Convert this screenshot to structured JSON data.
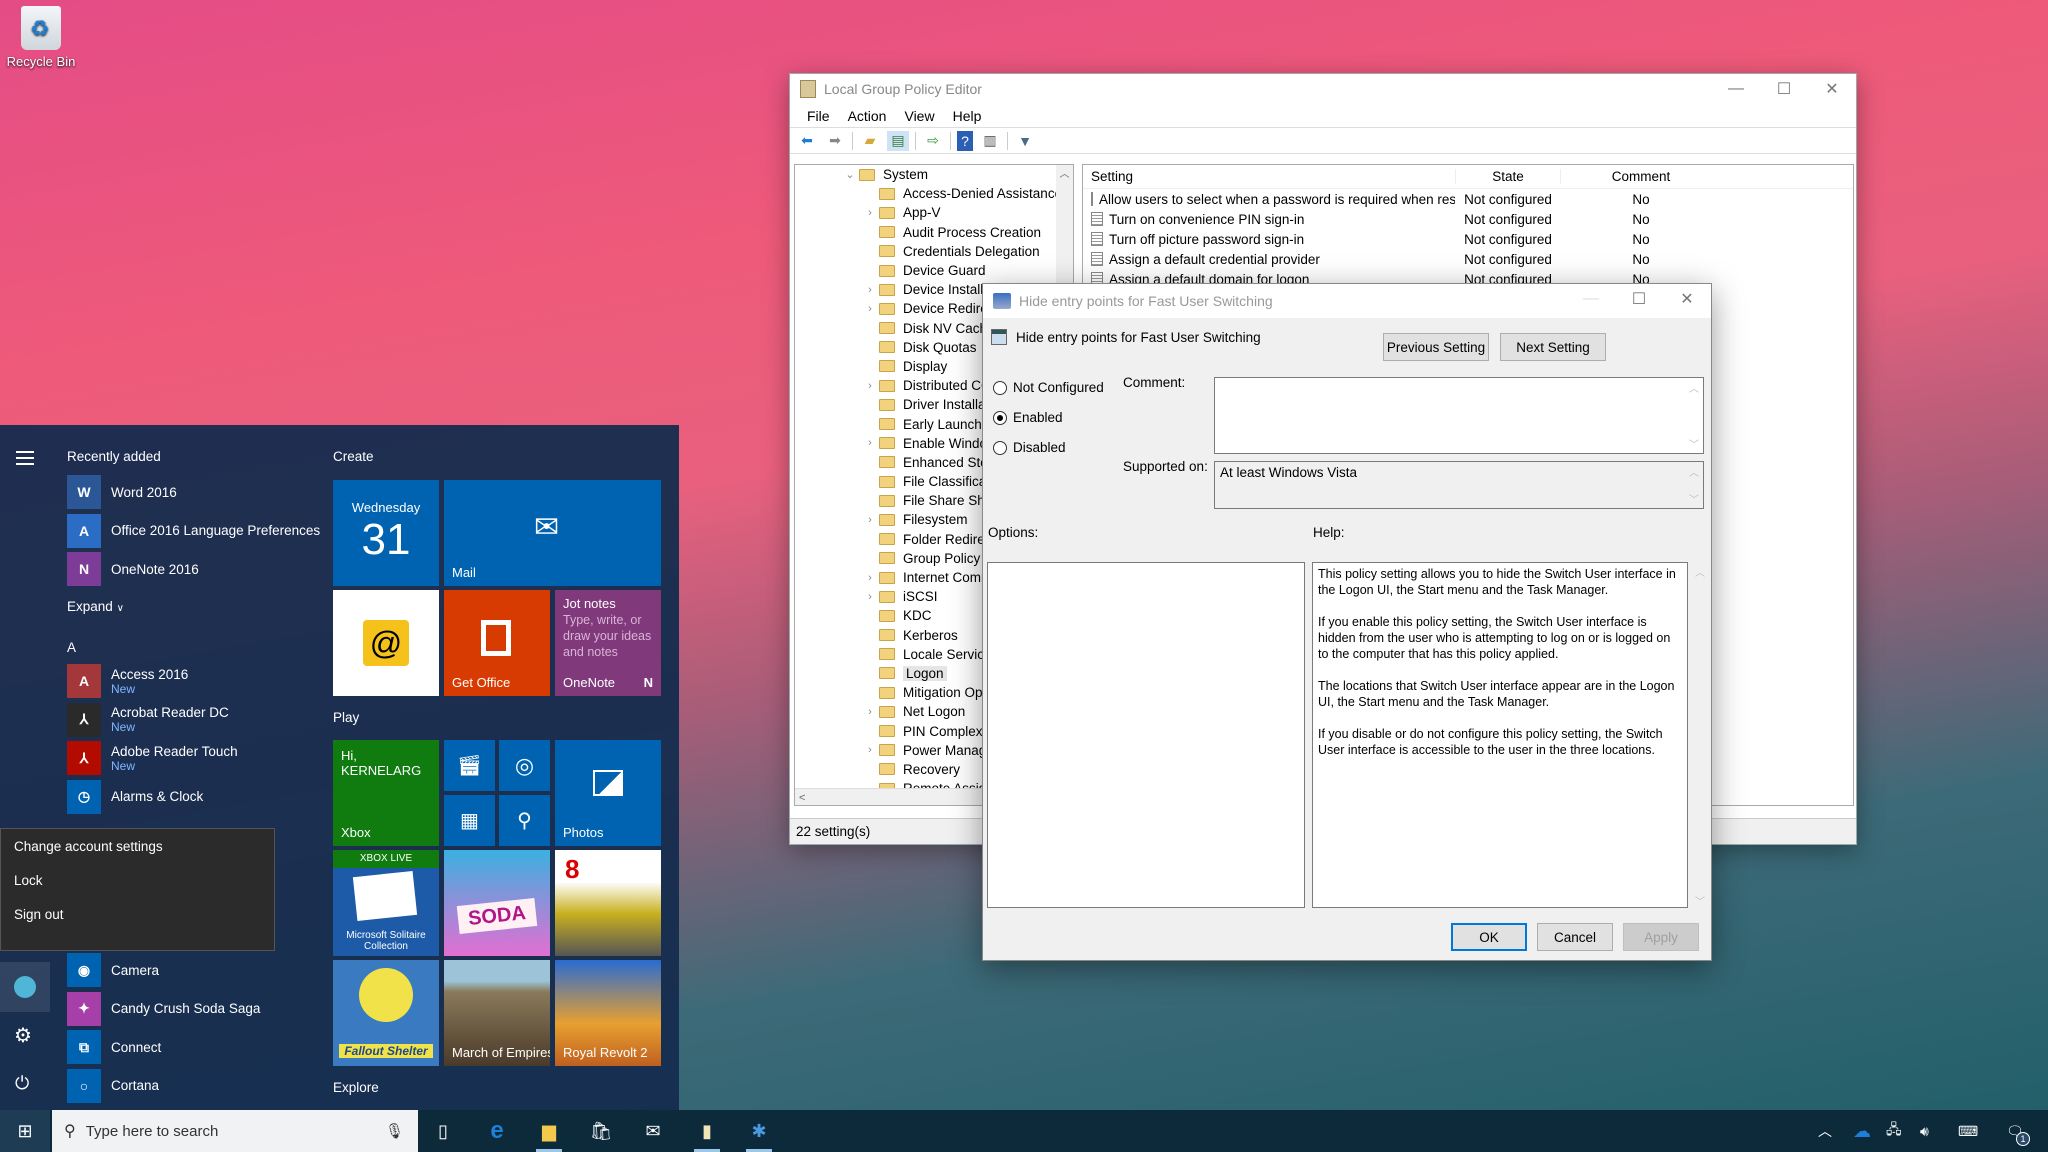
{
  "desktop": {
    "icons": [
      {
        "label": "Recycle Bin",
        "icon": "recycle-bin-icon"
      }
    ]
  },
  "gpe": {
    "title": "Local Group Policy Editor",
    "menu": [
      "File",
      "Action",
      "View",
      "Help"
    ],
    "toolbar": [
      "back-icon",
      "forward-icon",
      "up-folder-icon",
      "show-hide-tree-icon",
      "export-list-icon",
      "help-icon",
      "show-hide-action-pane-icon",
      "filter-icon"
    ],
    "tree": {
      "root": "System",
      "items": [
        {
          "label": "Access-Denied Assistance",
          "expandable": false
        },
        {
          "label": "App-V",
          "expandable": true
        },
        {
          "label": "Audit Process Creation",
          "expandable": false
        },
        {
          "label": "Credentials Delegation",
          "expandable": false
        },
        {
          "label": "Device Guard",
          "expandable": false
        },
        {
          "label": "Device Installation",
          "expandable": true
        },
        {
          "label": "Device Redirection",
          "expandable": true
        },
        {
          "label": "Disk NV Cache",
          "expandable": false
        },
        {
          "label": "Disk Quotas",
          "expandable": false
        },
        {
          "label": "Display",
          "expandable": false
        },
        {
          "label": "Distributed COM",
          "expandable": true
        },
        {
          "label": "Driver Installation",
          "expandable": false
        },
        {
          "label": "Early Launch Antimalware",
          "expandable": false
        },
        {
          "label": "Enable Windows NTP",
          "expandable": true
        },
        {
          "label": "Enhanced Storage Access",
          "expandable": false
        },
        {
          "label": "File Classification",
          "expandable": false
        },
        {
          "label": "File Share Shadow Copy",
          "expandable": false
        },
        {
          "label": "Filesystem",
          "expandable": true
        },
        {
          "label": "Folder Redirection",
          "expandable": false
        },
        {
          "label": "Group Policy",
          "expandable": false
        },
        {
          "label": "Internet Communication",
          "expandable": true
        },
        {
          "label": "iSCSI",
          "expandable": true
        },
        {
          "label": "KDC",
          "expandable": false
        },
        {
          "label": "Kerberos",
          "expandable": false
        },
        {
          "label": "Locale Services",
          "expandable": false
        },
        {
          "label": "Logon",
          "expandable": false,
          "selected": true
        },
        {
          "label": "Mitigation Options",
          "expandable": false
        },
        {
          "label": "Net Logon",
          "expandable": true
        },
        {
          "label": "PIN Complexity",
          "expandable": false
        },
        {
          "label": "Power Management",
          "expandable": true
        },
        {
          "label": "Recovery",
          "expandable": false
        },
        {
          "label": "Remote Assistance",
          "expandable": false
        }
      ]
    },
    "list": {
      "columns": [
        "Setting",
        "State",
        "Comment"
      ],
      "rows": [
        {
          "setting": "Allow users to select when a password is required when resu...",
          "state": "Not configured",
          "comment": "No"
        },
        {
          "setting": "Turn on convenience PIN sign-in",
          "state": "Not configured",
          "comment": "No"
        },
        {
          "setting": "Turn off picture password sign-in",
          "state": "Not configured",
          "comment": "No"
        },
        {
          "setting": "Assign a default credential provider",
          "state": "Not configured",
          "comment": "No"
        },
        {
          "setting": "Assign a default domain for logon",
          "state": "Not configured",
          "comment": "No"
        }
      ]
    },
    "status": "22 setting(s)"
  },
  "dialog": {
    "title": "Hide entry points for Fast User Switching",
    "heading": "Hide entry points for Fast User Switching",
    "prev_button": "Previous Setting",
    "next_button": "Next Setting",
    "options": [
      {
        "label": "Not Configured",
        "checked": false
      },
      {
        "label": "Enabled",
        "checked": true
      },
      {
        "label": "Disabled",
        "checked": false
      }
    ],
    "comment_label": "Comment:",
    "comment_value": "",
    "supported_label": "Supported on:",
    "supported_value": "At least Windows Vista",
    "options_label": "Options:",
    "help_label": "Help:",
    "help_text": [
      "This policy setting allows you to hide the Switch User interface in the Logon UI, the Start menu and the Task Manager.",
      "If you enable this policy setting, the Switch User interface is hidden from the user who is attempting to log on or is logged on to the computer that has this policy applied.",
      "The locations that Switch User interface appear are in the Logon UI, the Start menu and the Task Manager.",
      "If you disable or do not configure this policy setting, the Switch User interface is accessible to the user in the three locations."
    ],
    "ok": "OK",
    "cancel": "Cancel",
    "apply": "Apply"
  },
  "start": {
    "recently_added_label": "Recently added",
    "recent": [
      {
        "name": "Word 2016",
        "color": "#2b5797",
        "glyph": "W"
      },
      {
        "name": "Office 2016 Language Preferences",
        "color": "#2b6cc4",
        "glyph": "A"
      },
      {
        "name": "OneNote 2016",
        "color": "#7e3c99",
        "glyph": "N"
      }
    ],
    "expand_label": "Expand",
    "letter": "A",
    "apps": [
      {
        "name": "Access 2016",
        "badge": "New",
        "color": "#a4373a",
        "glyph": "A"
      },
      {
        "name": "Acrobat Reader DC",
        "badge": "New",
        "color": "#2a2a2a",
        "glyph": "⅄"
      },
      {
        "name": "Adobe Reader Touch",
        "badge": "New",
        "color": "#b30b00",
        "glyph": "⅄"
      },
      {
        "name": "Alarms & Clock",
        "badge": "",
        "color": "#0063b1",
        "glyph": "◷"
      }
    ],
    "apps_below": [
      {
        "name": "Camera",
        "color": "#0063b1",
        "glyph": "◉"
      },
      {
        "name": "Candy Crush Soda Saga",
        "color": "#a63fa8",
        "glyph": "✦"
      },
      {
        "name": "Connect",
        "color": "#0063b1",
        "glyph": "⧉"
      },
      {
        "name": "Cortana",
        "color": "#0063b1",
        "glyph": "○"
      }
    ],
    "account_menu": [
      "Change account settings",
      "Lock",
      "Sign out"
    ],
    "groups": {
      "create": "Create",
      "play": "Play",
      "explore": "Explore"
    },
    "tiles": {
      "calendar_day": "Wednesday",
      "calendar_date": "31",
      "mail": "Mail",
      "get_office": "Get Office",
      "onenote_title": "Jot notes",
      "onenote_desc": "Type, write, or draw your ideas and notes",
      "onenote": "OneNote",
      "xbox_greeting": "Hi, KERNELARG",
      "xbox": "Xbox",
      "photos": "Photos",
      "xbox_live": "XBOX LIVE",
      "solitaire": "Microsoft Solitaire Collection",
      "soda": "SODA",
      "asphalt": "8",
      "fallout": "Fallout Shelter",
      "march": "March of Empires",
      "royal": "Royal Revolt 2"
    }
  },
  "taskbar": {
    "search_placeholder": "Type here to search",
    "notification_count": "1"
  }
}
